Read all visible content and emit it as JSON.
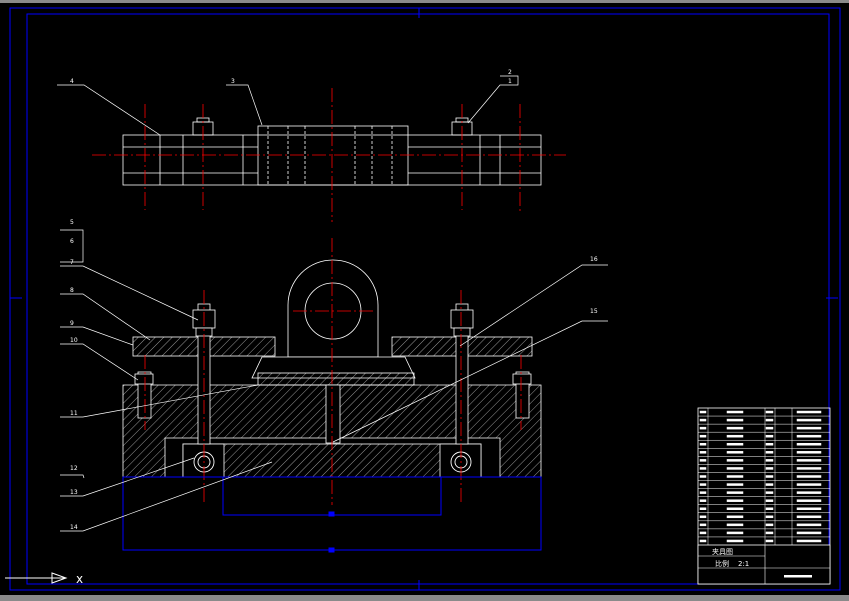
{
  "drawing": {
    "part_labels": [
      "1",
      "2",
      "3",
      "4",
      "5",
      "6",
      "7",
      "8",
      "9",
      "10",
      "11",
      "12",
      "13",
      "14",
      "15",
      "16"
    ]
  },
  "title_block": {
    "assembly_title": "夹具图",
    "scale_label": "比例",
    "scale": "2:1"
  },
  "colors": {
    "background": "#000000",
    "lines": "#ffffff",
    "center_lines": "#ff0000",
    "frame": "#0000ff"
  },
  "status": {
    "command_hint": "x"
  }
}
